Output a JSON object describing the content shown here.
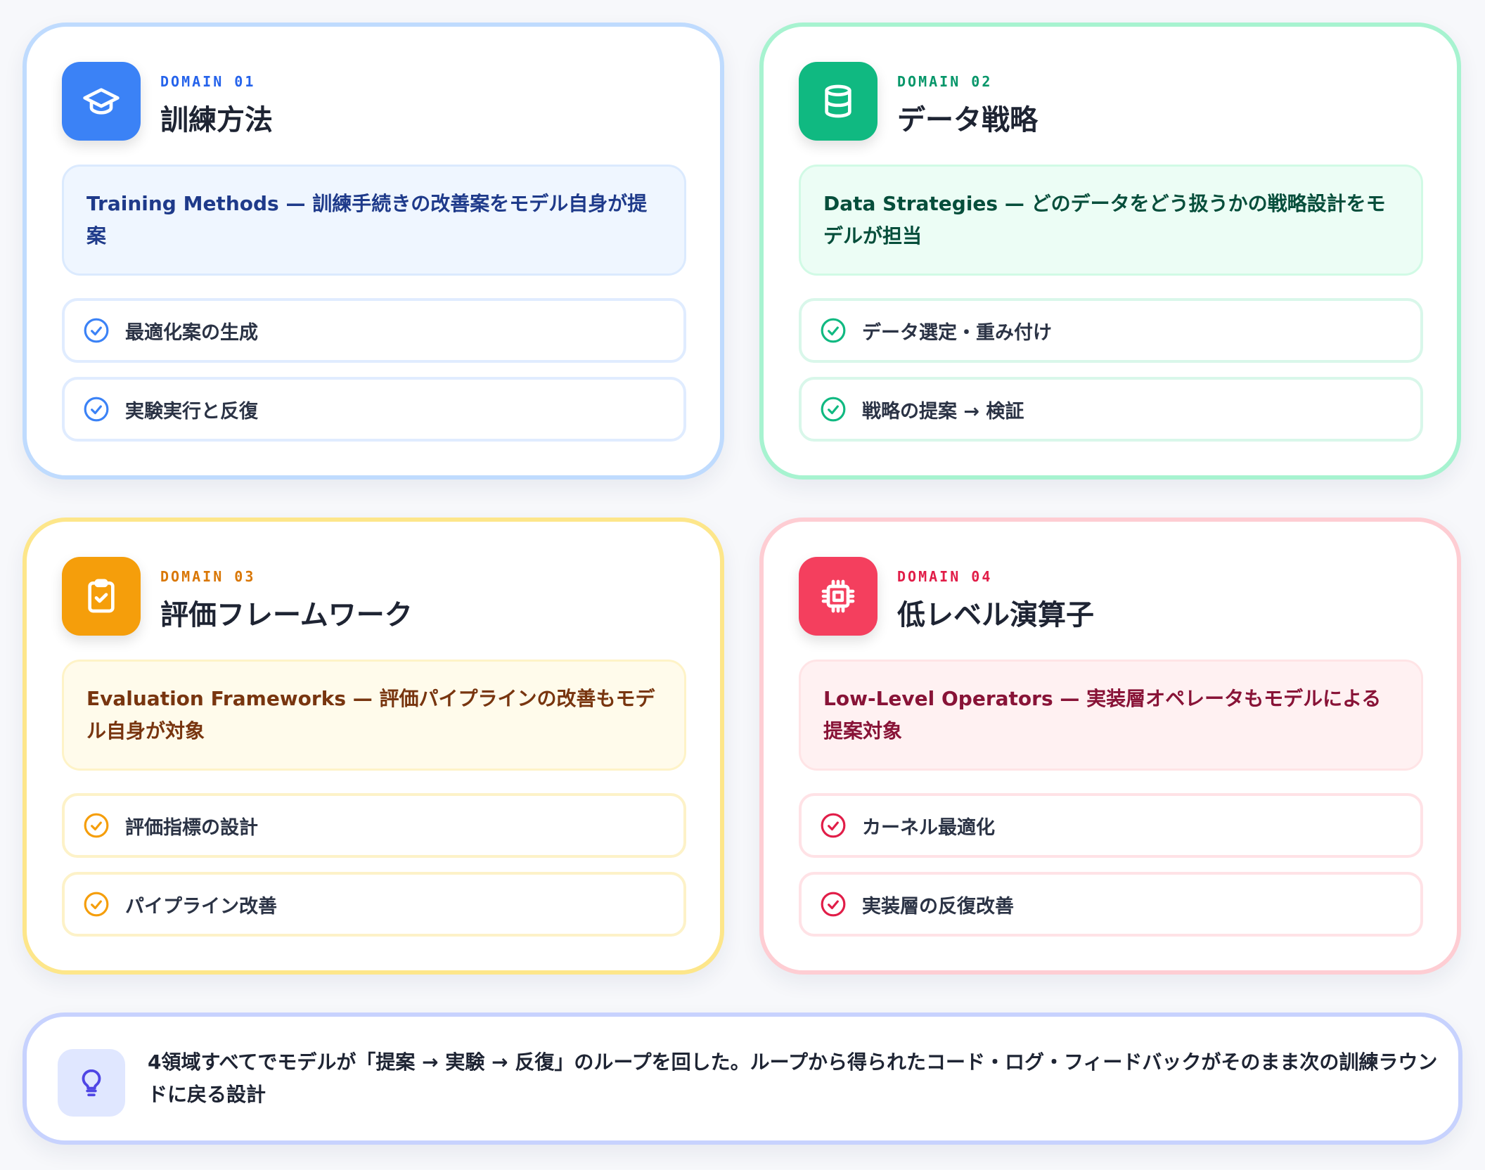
{
  "domains": [
    {
      "label": "DOMAIN 01",
      "title": "訓練方法",
      "description": "Training Methods — 訓練手続きの改善案をモデル自身が提案",
      "icon": "graduation-cap-icon",
      "accent": "#3b82f6",
      "features": [
        {
          "label": "最適化案の生成",
          "icon": "check-circle-icon"
        },
        {
          "label": "実験実行と反復",
          "icon": "check-circle-icon"
        }
      ]
    },
    {
      "label": "DOMAIN 02",
      "title": "データ戦略",
      "description": "Data Strategies — どのデータをどう扱うかの戦略設計をモデルが担当",
      "icon": "database-icon",
      "accent": "#10b981",
      "features": [
        {
          "label": "データ選定・重み付け",
          "icon": "check-circle-icon"
        },
        {
          "label": "戦略の提案 → 検証",
          "icon": "check-circle-icon"
        }
      ]
    },
    {
      "label": "DOMAIN 03",
      "title": "評価フレームワーク",
      "description": "Evaluation Frameworks — 評価パイプラインの改善もモデル自身が対象",
      "icon": "clipboard-check-icon",
      "accent": "#f59e0b",
      "features": [
        {
          "label": "評価指標の設計",
          "icon": "check-circle-icon"
        },
        {
          "label": "パイプライン改善",
          "icon": "check-circle-icon"
        }
      ]
    },
    {
      "label": "DOMAIN 04",
      "title": "低レベル演算子",
      "description": "Low-Level Operators — 実装層オペレータもモデルによる提案対象",
      "icon": "cpu-chip-icon",
      "accent": "#f43f5e",
      "features": [
        {
          "label": "カーネル最適化",
          "icon": "check-circle-icon"
        },
        {
          "label": "実装層の反復改善",
          "icon": "check-circle-icon"
        }
      ]
    }
  ],
  "footer": {
    "icon": "lightbulb-icon",
    "text": "4領域すべてでモデルが「提案 → 実験 → 反復」のループを回した。ループから得られたコード・ログ・フィードバックがそのまま次の訓練ラウンドに戻る設計"
  }
}
